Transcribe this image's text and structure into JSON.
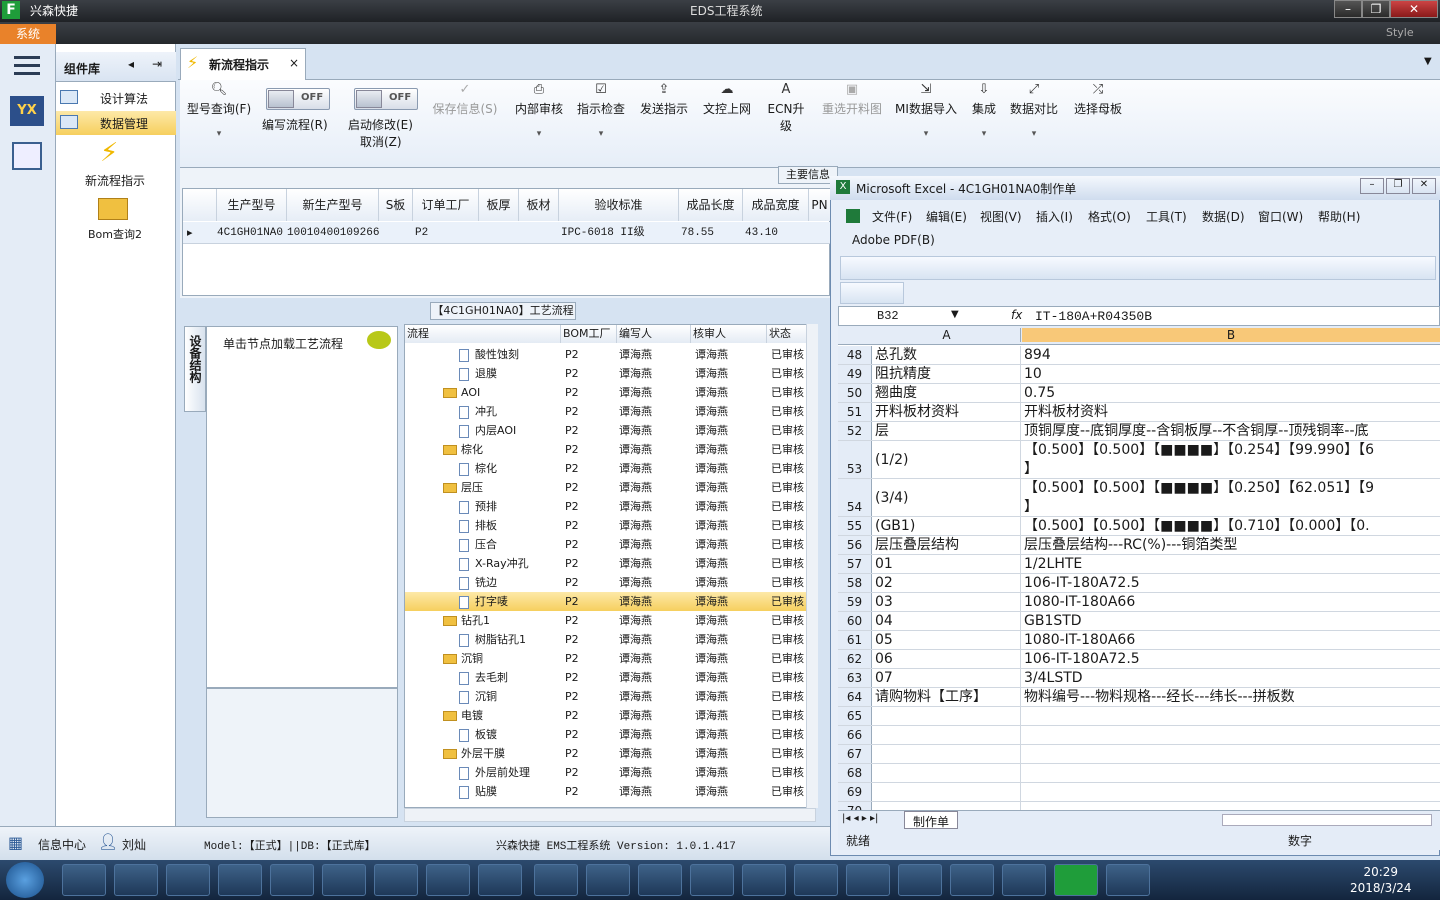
{
  "window": {
    "app_title": "兴森快捷",
    "center_title": "EDS工程系统",
    "system_tab": "系统",
    "style_label": "Style"
  },
  "library": {
    "title": "组件库",
    "items": [
      {
        "label": "设计算法"
      },
      {
        "label": "数据管理"
      }
    ],
    "tiles": [
      {
        "label": "新流程指示"
      },
      {
        "label": "Bom查询2"
      }
    ]
  },
  "tab": {
    "label": "新流程指示",
    "close": "×"
  },
  "ribbon": {
    "buttons": [
      {
        "label": "型号查询(F)"
      },
      {
        "label": "编写流程(R)"
      },
      {
        "label": "启动修改(E)",
        "sub": "取消(Z)"
      },
      {
        "label": "保存信息(S)"
      },
      {
        "label": "内部审核"
      },
      {
        "label": "指示检查"
      },
      {
        "label": "发送指示"
      },
      {
        "label": "文控上网"
      },
      {
        "label": "ECN升级"
      },
      {
        "label": "重选开料图"
      },
      {
        "label": "MI数据导入"
      },
      {
        "label": "集成"
      },
      {
        "label": "数据对比"
      },
      {
        "label": "选择母板"
      }
    ],
    "toggle_off": "OFF"
  },
  "main_info": "主要信息",
  "grid": {
    "headers": [
      "生产型号",
      "新生产型号",
      "S板",
      "订单工厂",
      "板厚",
      "板材",
      "验收标准",
      "成品长度",
      "成品宽度",
      "PN"
    ],
    "row": [
      "4C1GH01NA0",
      "10010400109266",
      "",
      "P2",
      "",
      "",
      "IPC-6018 II级",
      "78.55",
      "43.10",
      ""
    ]
  },
  "tree": {
    "title": "【4C1GH01NA0】工艺流程",
    "side_tab": "设备结构",
    "node_hint": "单击节点加载工艺流程",
    "headers": [
      "流程",
      "BOM工厂",
      "编写人",
      "核审人",
      "状态"
    ],
    "rows": [
      {
        "name": "酸性蚀刻",
        "lvl": 2,
        "type": "doc",
        "bom": "P2",
        "writer": "谭海燕",
        "reviewer": "谭海燕",
        "status": "已审核"
      },
      {
        "name": "退膜",
        "lvl": 2,
        "type": "doc",
        "bom": "P2",
        "writer": "谭海燕",
        "reviewer": "谭海燕",
        "status": "已审核"
      },
      {
        "name": "AOI",
        "lvl": 1,
        "type": "folder",
        "bom": "P2",
        "writer": "谭海燕",
        "reviewer": "谭海燕",
        "status": "已审核"
      },
      {
        "name": "冲孔",
        "lvl": 2,
        "type": "doc",
        "bom": "P2",
        "writer": "谭海燕",
        "reviewer": "谭海燕",
        "status": "已审核"
      },
      {
        "name": "内层AOI",
        "lvl": 2,
        "type": "doc",
        "bom": "P2",
        "writer": "谭海燕",
        "reviewer": "谭海燕",
        "status": "已审核"
      },
      {
        "name": "棕化",
        "lvl": 1,
        "type": "folder",
        "bom": "P2",
        "writer": "谭海燕",
        "reviewer": "谭海燕",
        "status": "已审核"
      },
      {
        "name": "棕化",
        "lvl": 2,
        "type": "doc",
        "bom": "P2",
        "writer": "谭海燕",
        "reviewer": "谭海燕",
        "status": "已审核"
      },
      {
        "name": "层压",
        "lvl": 1,
        "type": "folder",
        "bom": "P2",
        "writer": "谭海燕",
        "reviewer": "谭海燕",
        "status": "已审核"
      },
      {
        "name": "预排",
        "lvl": 2,
        "type": "doc",
        "bom": "P2",
        "writer": "谭海燕",
        "reviewer": "谭海燕",
        "status": "已审核"
      },
      {
        "name": "排板",
        "lvl": 2,
        "type": "doc",
        "bom": "P2",
        "writer": "谭海燕",
        "reviewer": "谭海燕",
        "status": "已审核"
      },
      {
        "name": "压合",
        "lvl": 2,
        "type": "doc",
        "bom": "P2",
        "writer": "谭海燕",
        "reviewer": "谭海燕",
        "status": "已审核"
      },
      {
        "name": "X-Ray冲孔",
        "lvl": 2,
        "type": "doc",
        "bom": "P2",
        "writer": "谭海燕",
        "reviewer": "谭海燕",
        "status": "已审核"
      },
      {
        "name": "铣边",
        "lvl": 2,
        "type": "doc",
        "bom": "P2",
        "writer": "谭海燕",
        "reviewer": "谭海燕",
        "status": "已审核"
      },
      {
        "name": "打字唛",
        "lvl": 2,
        "type": "doc",
        "bom": "P2",
        "writer": "谭海燕",
        "reviewer": "谭海燕",
        "status": "已审核",
        "selected": true
      },
      {
        "name": "钻孔1",
        "lvl": 1,
        "type": "folder",
        "bom": "P2",
        "writer": "谭海燕",
        "reviewer": "谭海燕",
        "status": "已审核"
      },
      {
        "name": "树脂钻孔1",
        "lvl": 2,
        "type": "doc",
        "bom": "P2",
        "writer": "谭海燕",
        "reviewer": "谭海燕",
        "status": "已审核"
      },
      {
        "name": "沉铜",
        "lvl": 1,
        "type": "folder",
        "bom": "P2",
        "writer": "谭海燕",
        "reviewer": "谭海燕",
        "status": "已审核"
      },
      {
        "name": "去毛刺",
        "lvl": 2,
        "type": "doc",
        "bom": "P2",
        "writer": "谭海燕",
        "reviewer": "谭海燕",
        "status": "已审核"
      },
      {
        "name": "沉铜",
        "lvl": 2,
        "type": "doc",
        "bom": "P2",
        "writer": "谭海燕",
        "reviewer": "谭海燕",
        "status": "已审核"
      },
      {
        "name": "电镀",
        "lvl": 1,
        "type": "folder",
        "bom": "P2",
        "writer": "谭海燕",
        "reviewer": "谭海燕",
        "status": "已审核"
      },
      {
        "name": "板镀",
        "lvl": 2,
        "type": "doc",
        "bom": "P2",
        "writer": "谭海燕",
        "reviewer": "谭海燕",
        "status": "已审核"
      },
      {
        "name": "外层干膜",
        "lvl": 1,
        "type": "folder",
        "bom": "P2",
        "writer": "谭海燕",
        "reviewer": "谭海燕",
        "status": "已审核"
      },
      {
        "name": "外层前处理",
        "lvl": 2,
        "type": "doc",
        "bom": "P2",
        "writer": "谭海燕",
        "reviewer": "谭海燕",
        "status": "已审核"
      },
      {
        "name": "贴膜",
        "lvl": 2,
        "type": "doc",
        "bom": "P2",
        "writer": "谭海燕",
        "reviewer": "谭海燕",
        "status": "已审核"
      }
    ]
  },
  "status": {
    "info_center": "信息中心",
    "user": "刘灿",
    "model_db": "Model:【正式】||DB:【正式库】",
    "version": "兴森快捷 EMS工程系统 Version: 1.0.1.417"
  },
  "excel": {
    "title": "Microsoft Excel - 4C1GH01NA0制作单",
    "menus": [
      "文件(F)",
      "编辑(E)",
      "视图(V)",
      "插入(I)",
      "格式(O)",
      "工具(T)",
      "数据(D)",
      "窗口(W)",
      "帮助(H)"
    ],
    "pdf_menu": "Adobe PDF(B)",
    "name_box": "B32",
    "fx": "fx",
    "formula": "IT-180A+R04350B",
    "col_a": "A",
    "col_b": "B",
    "rows": [
      {
        "n": "48",
        "a": "总孔数",
        "b": "894"
      },
      {
        "n": "49",
        "a": "阻抗精度",
        "b": "10"
      },
      {
        "n": "50",
        "a": "翘曲度",
        "b": "0.75"
      },
      {
        "n": "51",
        "a": "开料板材资料",
        "b": "开料板材资料"
      },
      {
        "n": "52",
        "a": "层",
        "b": "顶铜厚度--底铜厚度--含铜板厚--不含铜厚--顶残铜率--底"
      },
      {
        "n": "53",
        "a": "(1/2)",
        "b": "【0.500】【0.500】【■■■■】【0.254】【99.990】【6",
        "b2": "】",
        "tall": true
      },
      {
        "n": "54",
        "a": "(3/4)",
        "b": "【0.500】【0.500】【■■■■】【0.250】【62.051】【9",
        "b2": "】",
        "tall": true
      },
      {
        "n": "55",
        "a": "(GB1)",
        "b": "【0.500】【0.500】【■■■■】【0.710】【0.000】【0."
      },
      {
        "n": "56",
        "a": "层压叠层结构",
        "b": "层压叠层结构---RC(%)---铜箔类型"
      },
      {
        "n": "57",
        "a": "01",
        "b": "1/2LHTE"
      },
      {
        "n": "58",
        "a": "02",
        "b": "106-IT-180A72.5"
      },
      {
        "n": "59",
        "a": "03",
        "b": "1080-IT-180A66"
      },
      {
        "n": "60",
        "a": "04",
        "b": "GB1STD"
      },
      {
        "n": "61",
        "a": "05",
        "b": "1080-IT-180A66"
      },
      {
        "n": "62",
        "a": "06",
        "b": "106-IT-180A72.5"
      },
      {
        "n": "63",
        "a": "07",
        "b": "3/4LSTD"
      },
      {
        "n": "64",
        "a": "请购物料【工序】",
        "b": "物料编号---物料规格---经长---纬长---拼板数"
      },
      {
        "n": "65",
        "a": "",
        "b": ""
      },
      {
        "n": "66",
        "a": "",
        "b": ""
      },
      {
        "n": "67",
        "a": "",
        "b": ""
      },
      {
        "n": "68",
        "a": "",
        "b": ""
      },
      {
        "n": "69",
        "a": "",
        "b": ""
      },
      {
        "n": "70",
        "a": "",
        "b": ""
      }
    ],
    "sheet_tab": "制作单",
    "status_ready": "就绪",
    "status_num": "数字"
  },
  "taskbar": {
    "time": "20:29",
    "date": "2018/3/24"
  }
}
